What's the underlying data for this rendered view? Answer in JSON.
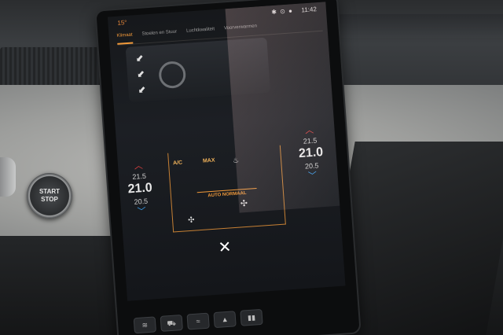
{
  "status_bar": {
    "outside_temp": "15°",
    "icons": "✱ ⊙ ●",
    "time": "11:42"
  },
  "tabs": [
    {
      "label": "Klimaat",
      "active": true
    },
    {
      "label": "Stoelen en Stuur",
      "active": false
    },
    {
      "label": "Luchtkwaliteit",
      "active": false
    },
    {
      "label": "Voorverwarmen",
      "active": false
    }
  ],
  "climate": {
    "ac_label": "A/C",
    "max_label": "MAX",
    "auto_label": "AUTO NORMAAL"
  },
  "left_zone": {
    "temp_above": "21.5",
    "temp_current": "21.0",
    "temp_below": "20.5"
  },
  "right_zone": {
    "temp_above": "21.5",
    "temp_current": "21.0",
    "temp_below": "20.5"
  },
  "start_stop": {
    "line1": "START",
    "line2": "STOP"
  },
  "icons": {
    "close": "close-icon",
    "up": "chevron-up-icon",
    "down": "chevron-down-icon",
    "fan": "fan-icon",
    "seat": "seat-heat-icon",
    "steering": "steering-wheel-icon"
  },
  "colors": {
    "accent": "#f29a3a",
    "temp_up": "#e04040",
    "temp_down": "#3aa0f0"
  }
}
